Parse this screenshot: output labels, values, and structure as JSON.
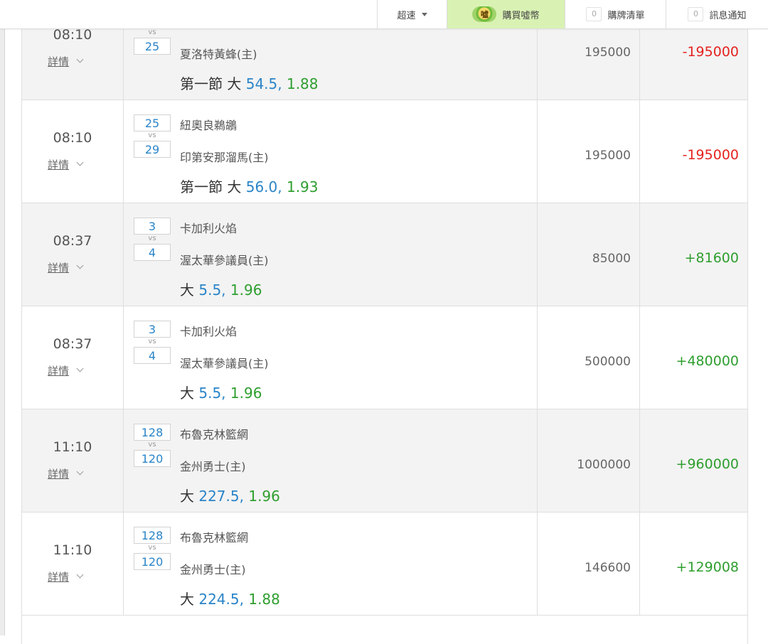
{
  "nav": {
    "speed_label": "超速",
    "buy_coin_icon_text": "噓",
    "buy_label": "購買噓幣",
    "bet_list_count": "0",
    "bet_list_label": "購牌清單",
    "messages_count": "0",
    "messages_label": "訊息通知"
  },
  "colors": {
    "accent_blue": "#2a84c8",
    "odds_green": "#2e9e2e",
    "loss_red": "#e4231f",
    "buy_bg": "#d9f2b4"
  },
  "rows": [
    {
      "time": "08:10",
      "detail": "詳情",
      "score_away": "",
      "vs": "vs",
      "score_home": "25",
      "team_away": "",
      "team_home": "夏洛特黃蜂(主)",
      "bet_prefix": "第一節 大 ",
      "bet_line": "54.5,",
      "bet_odds": " 1.88",
      "stake": "195000",
      "result": "-195000",
      "result_type": "neg"
    },
    {
      "time": "08:10",
      "detail": "詳情",
      "score_away": "25",
      "vs": "vs",
      "score_home": "29",
      "team_away": "紐奧良鵜鶘",
      "team_home": "印第安那溜馬(主)",
      "bet_prefix": "第一節 大 ",
      "bet_line": "56.0,",
      "bet_odds": " 1.93",
      "stake": "195000",
      "result": "-195000",
      "result_type": "neg"
    },
    {
      "time": "08:37",
      "detail": "詳情",
      "score_away": "3",
      "vs": "vs",
      "score_home": "4",
      "team_away": "卡加利火焰",
      "team_home": "渥太華參議員(主)",
      "bet_prefix": "大 ",
      "bet_line": "5.5,",
      "bet_odds": " 1.96",
      "stake": "85000",
      "result": "+81600",
      "result_type": "pos"
    },
    {
      "time": "08:37",
      "detail": "詳情",
      "score_away": "3",
      "vs": "vs",
      "score_home": "4",
      "team_away": "卡加利火焰",
      "team_home": "渥太華參議員(主)",
      "bet_prefix": "大 ",
      "bet_line": "5.5,",
      "bet_odds": " 1.96",
      "stake": "500000",
      "result": "+480000",
      "result_type": "pos"
    },
    {
      "time": "11:10",
      "detail": "詳情",
      "score_away": "128",
      "vs": "vs",
      "score_home": "120",
      "team_away": "布魯克林籃網",
      "team_home": "金州勇士(主)",
      "bet_prefix": "大 ",
      "bet_line": "227.5,",
      "bet_odds": " 1.96",
      "stake": "1000000",
      "result": "+960000",
      "result_type": "pos"
    },
    {
      "time": "11:10",
      "detail": "詳情",
      "score_away": "128",
      "vs": "vs",
      "score_home": "120",
      "team_away": "布魯克林籃網",
      "team_home": "金州勇士(主)",
      "bet_prefix": "大 ",
      "bet_line": "224.5,",
      "bet_odds": " 1.88",
      "stake": "146600",
      "result": "+129008",
      "result_type": "pos"
    }
  ]
}
